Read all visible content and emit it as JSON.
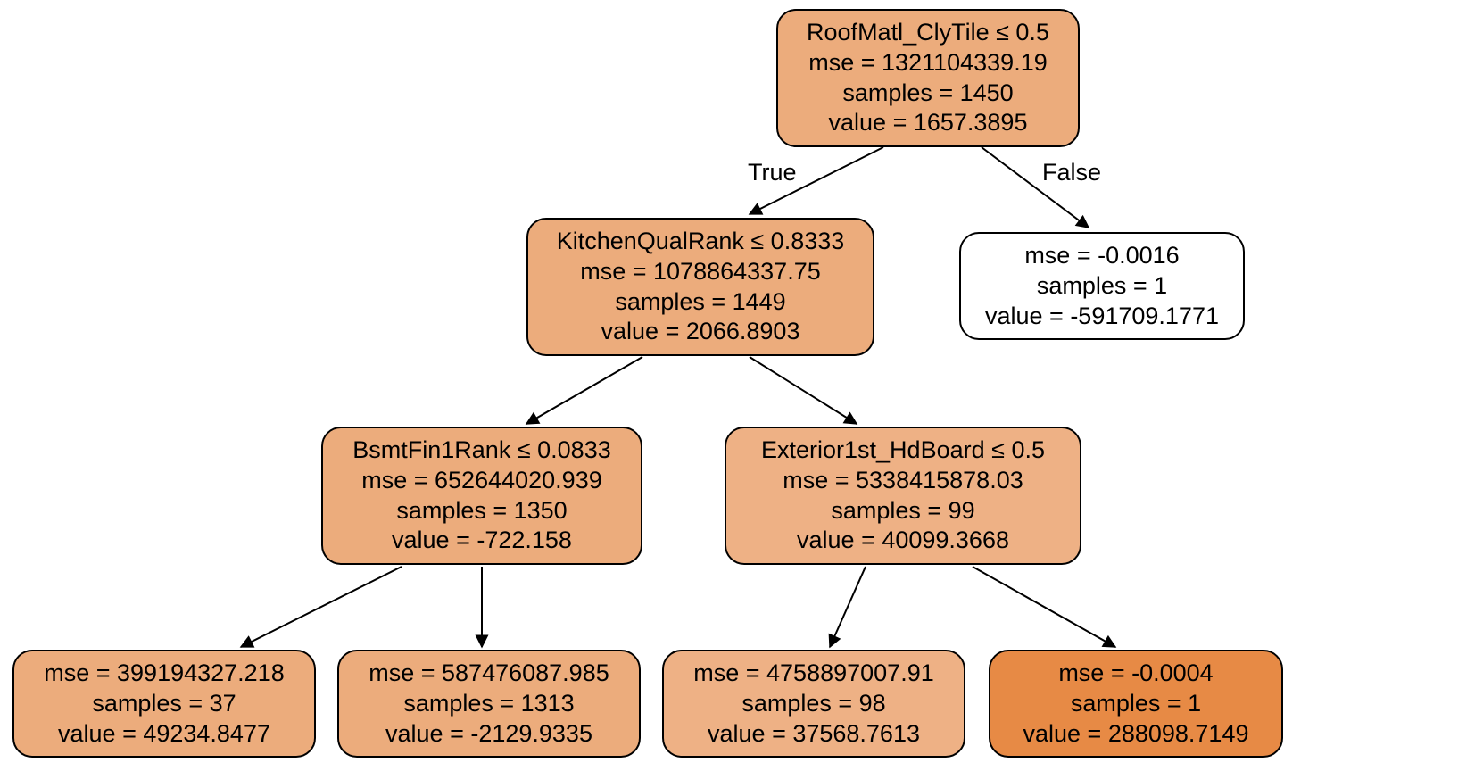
{
  "colors": {
    "mid": "#ecac7c",
    "light": "#eeb185",
    "white": "#ffffff",
    "dark": "#e78a45"
  },
  "edge_labels": {
    "true": "True",
    "false": "False"
  },
  "nodes": {
    "root": {
      "lines": [
        "RoofMatl_ClyTile ≤ 0.5",
        "mse = 1321104339.19",
        "samples = 1450",
        "value = 1657.3895"
      ]
    },
    "n_left": {
      "lines": [
        "KitchenQualRank ≤ 0.8333",
        "mse = 1078864337.75",
        "samples = 1449",
        "value = 2066.8903"
      ]
    },
    "n_right": {
      "lines": [
        "mse = -0.0016",
        "samples = 1",
        "value = -591709.1771"
      ]
    },
    "n_ll": {
      "lines": [
        "BsmtFin1Rank ≤ 0.0833",
        "mse = 652644020.939",
        "samples = 1350",
        "value = -722.158"
      ]
    },
    "n_lr": {
      "lines": [
        "Exterior1st_HdBoard ≤ 0.5",
        "mse = 5338415878.03",
        "samples = 99",
        "value = 40099.3668"
      ]
    },
    "leaf_lll": {
      "lines": [
        "mse = 399194327.218",
        "samples = 37",
        "value = 49234.8477"
      ]
    },
    "leaf_llr": {
      "lines": [
        "mse = 587476087.985",
        "samples = 1313",
        "value = -2129.9335"
      ]
    },
    "leaf_lrl": {
      "lines": [
        "mse = 4758897007.91",
        "samples = 98",
        "value = 37568.7613"
      ]
    },
    "leaf_lrr": {
      "lines": [
        "mse = -0.0004",
        "samples = 1",
        "value = 288098.7149"
      ]
    }
  },
  "chart_data": {
    "type": "tree",
    "description": "Decision tree regressor visualization (depth 3)",
    "root": {
      "split": "RoofMatl_ClyTile ≤ 0.5",
      "mse": 1321104339.19,
      "samples": 1450,
      "value": 1657.3895,
      "true": {
        "split": "KitchenQualRank ≤ 0.8333",
        "mse": 1078864337.75,
        "samples": 1449,
        "value": 2066.8903,
        "true": {
          "split": "BsmtFin1Rank ≤ 0.0833",
          "mse": 652644020.939,
          "samples": 1350,
          "value": -722.158,
          "true": {
            "mse": 399194327.218,
            "samples": 37,
            "value": 49234.8477
          },
          "false": {
            "mse": 587476087.985,
            "samples": 1313,
            "value": -2129.9335
          }
        },
        "false": {
          "split": "Exterior1st_HdBoard ≤ 0.5",
          "mse": 5338415878.03,
          "samples": 99,
          "value": 40099.3668,
          "true": {
            "mse": 4758897007.91,
            "samples": 98,
            "value": 37568.7613
          },
          "false": {
            "mse": -0.0004,
            "samples": 1,
            "value": 288098.7149
          }
        }
      },
      "false": {
        "mse": -0.0016,
        "samples": 1,
        "value": -591709.1771
      }
    }
  }
}
